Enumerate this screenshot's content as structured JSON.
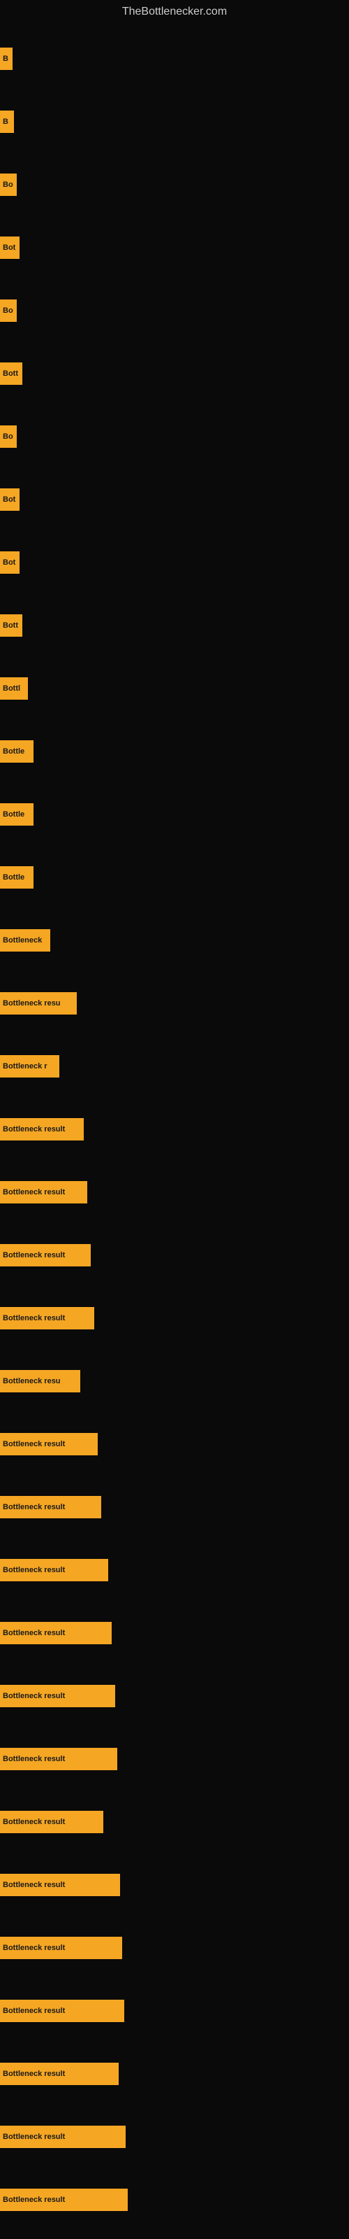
{
  "site": {
    "title": "TheBottlenecker.com"
  },
  "bars": [
    {
      "id": 1,
      "label": "B",
      "width": 18
    },
    {
      "id": 2,
      "label": "B",
      "width": 20
    },
    {
      "id": 3,
      "label": "Bo",
      "width": 24
    },
    {
      "id": 4,
      "label": "Bot",
      "width": 28
    },
    {
      "id": 5,
      "label": "Bo",
      "width": 24
    },
    {
      "id": 6,
      "label": "Bott",
      "width": 32
    },
    {
      "id": 7,
      "label": "Bo",
      "width": 24
    },
    {
      "id": 8,
      "label": "Bot",
      "width": 28
    },
    {
      "id": 9,
      "label": "Bot",
      "width": 28
    },
    {
      "id": 10,
      "label": "Bott",
      "width": 32
    },
    {
      "id": 11,
      "label": "Bottl",
      "width": 40
    },
    {
      "id": 12,
      "label": "Bottle",
      "width": 48
    },
    {
      "id": 13,
      "label": "Bottle",
      "width": 48
    },
    {
      "id": 14,
      "label": "Bottle",
      "width": 48
    },
    {
      "id": 15,
      "label": "Bottleneck",
      "width": 72
    },
    {
      "id": 16,
      "label": "Bottleneck resu",
      "width": 110
    },
    {
      "id": 17,
      "label": "Bottleneck r",
      "width": 85
    },
    {
      "id": 18,
      "label": "Bottleneck result",
      "width": 120
    },
    {
      "id": 19,
      "label": "Bottleneck result",
      "width": 125
    },
    {
      "id": 20,
      "label": "Bottleneck result",
      "width": 130
    },
    {
      "id": 21,
      "label": "Bottleneck result",
      "width": 135
    },
    {
      "id": 22,
      "label": "Bottleneck resu",
      "width": 115
    },
    {
      "id": 23,
      "label": "Bottleneck result",
      "width": 140
    },
    {
      "id": 24,
      "label": "Bottleneck result",
      "width": 145
    },
    {
      "id": 25,
      "label": "Bottleneck result",
      "width": 155
    },
    {
      "id": 26,
      "label": "Bottleneck result",
      "width": 160
    },
    {
      "id": 27,
      "label": "Bottleneck result",
      "width": 165
    },
    {
      "id": 28,
      "label": "Bottleneck result",
      "width": 168
    },
    {
      "id": 29,
      "label": "Bottleneck result",
      "width": 148
    },
    {
      "id": 30,
      "label": "Bottleneck result",
      "width": 172
    },
    {
      "id": 31,
      "label": "Bottleneck result",
      "width": 175
    },
    {
      "id": 32,
      "label": "Bottleneck result",
      "width": 178
    },
    {
      "id": 33,
      "label": "Bottleneck result",
      "width": 170
    },
    {
      "id": 34,
      "label": "Bottleneck result",
      "width": 180
    },
    {
      "id": 35,
      "label": "Bottleneck result",
      "width": 183
    }
  ]
}
